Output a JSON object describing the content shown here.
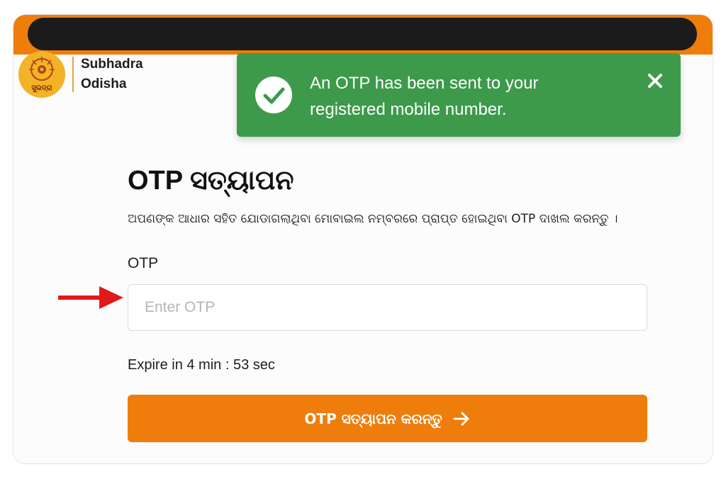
{
  "header": {
    "brand_line1": "Subhadra",
    "brand_line2": "Odisha",
    "logo_text": "ସୁଭଦ୍ରା"
  },
  "toast": {
    "message": "An OTP has been sent to your registered mobile number.",
    "type": "success",
    "icon": "check-circle-icon",
    "close_icon": "close-icon",
    "color": "#3d9a4b"
  },
  "main": {
    "title": "OTP ସତ୍ୟାପନ",
    "subtitle": "ଅପଣଙ୍କ ଆଧାର ସହିତ ଯୋଡାଗଲାଥିବା ମୋବାଇଲ ନମ୍ବରରେ ପ୍ରାପ୍ତ ହୋଇଥିବା OTP ଦାଖଲ କରନ୍ତୁ ।",
    "otp_label": "OTP",
    "otp_placeholder": "Enter OTP",
    "otp_value": "",
    "expire_text": "Expire in 4 min : 53 sec",
    "submit_label": "OTP ସତ୍ୟାପନ କରନ୍ତୁ",
    "submit_icon": "arrow-right-icon"
  },
  "colors": {
    "accent": "#ef7d0c",
    "success": "#3d9a4b",
    "annotation_arrow": "#e0191b"
  }
}
